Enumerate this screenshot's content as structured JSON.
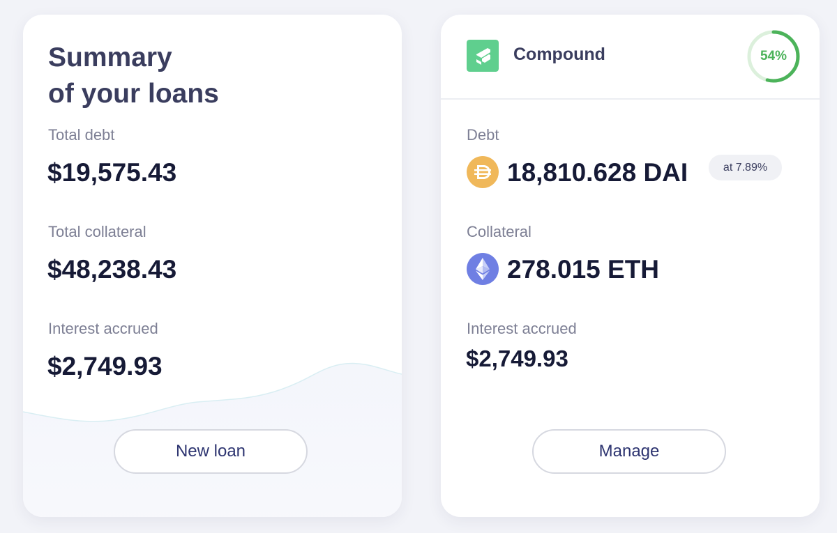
{
  "summary": {
    "title_line1": "Summary",
    "title_line2": "of your loans",
    "total_debt_label": "Total debt",
    "total_debt_value": "$19,575.43",
    "total_collateral_label": "Total collateral",
    "total_collateral_value": "$48,238.43",
    "interest_label": "Interest accrued",
    "interest_value": "$2,749.93",
    "new_loan_button": "New loan"
  },
  "loan": {
    "protocol_name": "Compound",
    "protocol_icon": "compound-logo",
    "health_percent": 54,
    "health_label": "54%",
    "debt_label": "Debt",
    "debt_value": "18,810.628 DAI",
    "debt_icon": "dai-coin-icon",
    "debt_rate": "at 7.89%",
    "collateral_label": "Collateral",
    "collateral_value": "278.015 ETH",
    "collateral_icon": "eth-coin-icon",
    "interest_label": "Interest accrued",
    "interest_value": "$2,749.93",
    "manage_button": "Manage"
  },
  "colors": {
    "background": "#f2f3f8",
    "card": "#ffffff",
    "heading": "#3a3d5e",
    "value": "#161a36",
    "label": "#7d7f94",
    "button_text": "#2d3470",
    "compound_green": "#5fcf8e",
    "health_green": "#4cb35a",
    "health_track": "#dcf0dc",
    "dai_gold": "#f0b85a",
    "eth_blue": "#6f7fe3"
  }
}
